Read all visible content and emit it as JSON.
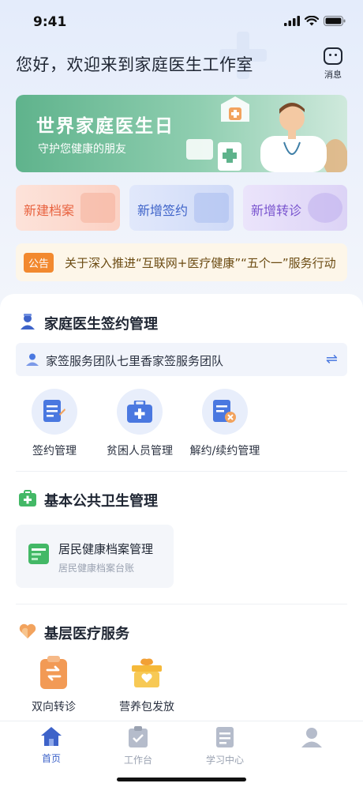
{
  "status": {
    "time": "9:41"
  },
  "header": {
    "greeting": "您好，欢迎来到家庭医生工作室",
    "msg_label": "消息"
  },
  "banner": {
    "title": "世界家庭医生日",
    "subtitle": "守护您健康的朋友"
  },
  "quick_actions": [
    {
      "label": "新建档案"
    },
    {
      "label": "新增签约"
    },
    {
      "label": "新增转诊"
    }
  ],
  "notice": {
    "tag": "公告",
    "text": "关于深入推进“互联网+医疗健康”“五个一”服务行动"
  },
  "sign_section": {
    "title": "家庭医生签约管理",
    "team": "家签服务团队七里香家签服务团队",
    "features": [
      {
        "label": "签约管理"
      },
      {
        "label": "贫困人员管理"
      },
      {
        "label": "解约/续约管理"
      }
    ]
  },
  "public_section": {
    "title": "基本公共卫生管理",
    "archive_title": "居民健康档案管理",
    "archive_sub": "居民健康档案台账"
  },
  "basic_section": {
    "title": "基层医疗服务",
    "items": [
      {
        "label": "双向转诊"
      },
      {
        "label": "营养包发放"
      }
    ]
  },
  "tabs": [
    {
      "label": "首页"
    },
    {
      "label": "工作台"
    },
    {
      "label": "学习中心"
    },
    {
      "label": ""
    }
  ],
  "colors": {
    "accent": "#3e63c9",
    "banner_green": "#5fb38c",
    "notice_orange": "#f2892f"
  }
}
